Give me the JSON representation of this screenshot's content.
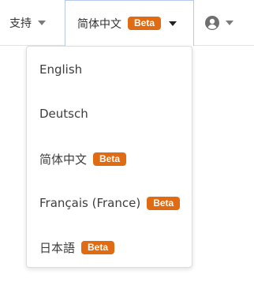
{
  "nav": {
    "support_label": "支持",
    "language_label": "简体中文",
    "language_badge": "Beta",
    "user_icon": "user-circle-icon"
  },
  "language_menu": {
    "items": [
      {
        "label": "English",
        "badge": ""
      },
      {
        "label": "Deutsch",
        "badge": ""
      },
      {
        "label": "简体中文",
        "badge": "Beta"
      },
      {
        "label": "Français (France)",
        "badge": "Beta"
      },
      {
        "label": "日本語",
        "badge": "Beta"
      }
    ]
  },
  "colors": {
    "badge": "#e06b13",
    "active_border": "#b7c9ea",
    "text": "#3d3d3d"
  }
}
